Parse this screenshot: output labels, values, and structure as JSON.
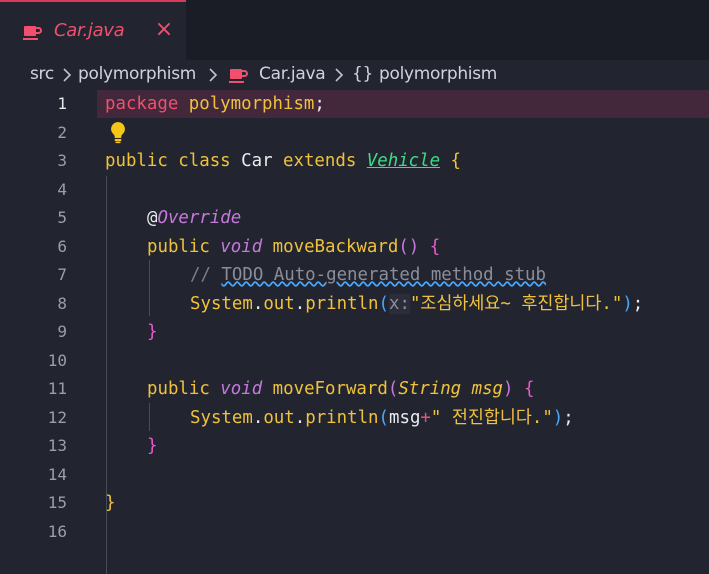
{
  "tab": {
    "title": "Car.java",
    "icon": "java-cup-icon",
    "close": "×"
  },
  "breadcrumb": {
    "items": [
      "src",
      "polymorphism",
      "Car.java",
      "{}",
      "polymorphism"
    ]
  },
  "editor": {
    "line_numbers": [
      "1",
      "2",
      "3",
      "4",
      "5",
      "6",
      "7",
      "8",
      "9",
      "10",
      "11",
      "12",
      "13",
      "14",
      "15",
      "16"
    ],
    "active_line": "1",
    "lines": {
      "l1": {
        "kw": "package",
        "name": " polymorphism",
        "semi": ";"
      },
      "l3": {
        "public": "public",
        "class": " class ",
        "name": "Car",
        "extends": " extends ",
        "parent": "Vehicle",
        "brace": " {"
      },
      "l5": {
        "at": "@",
        "annotation": "Override"
      },
      "l6": {
        "public": "public ",
        "void": "void",
        "name": " moveBackward",
        "params": "()",
        "brace": " {"
      },
      "l7": {
        "comment_prefix": "// ",
        "todo": "TODO Auto-generated method stub"
      },
      "l8": {
        "system": "System",
        "dot1": ".",
        "out": "out",
        "dot2": ".",
        "method": "println",
        "lparen": "(",
        "hint": "x:",
        "string": "\"조심하세요~ 후진합니다.\"",
        "rparen": ")",
        "semi": ";"
      },
      "l9": {
        "brace": "}"
      },
      "l11": {
        "public": "public ",
        "void": "void",
        "name": " moveForward",
        "lparen": "(",
        "type": "String",
        "param": " msg",
        "rparen": ")",
        "brace": " {"
      },
      "l12": {
        "system": "System",
        "dot1": ".",
        "out": "out",
        "dot2": ".",
        "method": "println",
        "lparen": "(",
        "arg": "msg",
        "plus": "+",
        "string": "\" 전진합니다.\"",
        "rparen": ")",
        "semi": ";"
      },
      "l13": {
        "brace": "}"
      },
      "l15": {
        "brace": "}"
      }
    },
    "lightbulb": "lightbulb-icon"
  },
  "colors": {
    "background": "#22252f",
    "tab_accent": "#f0506e",
    "keyword": "#f0c23c",
    "type_green": "#3ddc84",
    "purple": "#c678dd",
    "line_highlight": "#43273a"
  }
}
